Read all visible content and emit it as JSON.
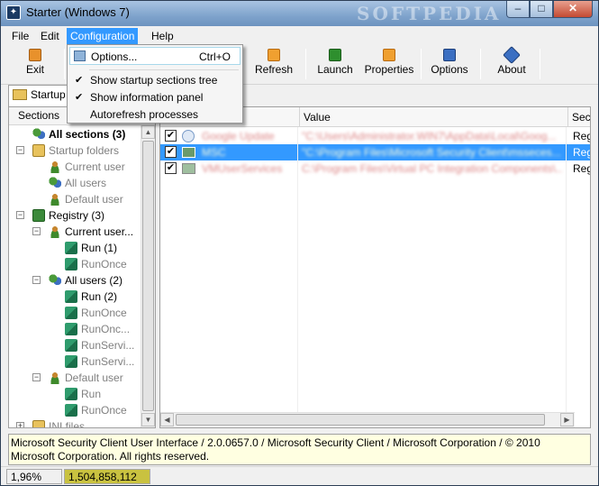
{
  "window": {
    "title": "Starter (Windows 7)",
    "watermark": "SOFTPEDIA",
    "min": "–",
    "max": "□",
    "close": "✕"
  },
  "menubar": {
    "file": "File",
    "edit": "Edit",
    "configuration": "Configuration",
    "help": "Help"
  },
  "toolbar": {
    "exit": "Exit",
    "refresh": "Refresh",
    "launch": "Launch",
    "properties": "Properties",
    "options": "Options",
    "about": "About"
  },
  "tab": {
    "label": "Startup"
  },
  "left": {
    "header": "Sections",
    "items": [
      {
        "label": "All sections (3)"
      },
      {
        "label": "Startup folders"
      },
      {
        "label": "Current user"
      },
      {
        "label": "All users"
      },
      {
        "label": "Default user"
      },
      {
        "label": "Registry (3)"
      },
      {
        "label": "Current user..."
      },
      {
        "label": "Run (1)"
      },
      {
        "label": "RunOnce"
      },
      {
        "label": "All users (2)"
      },
      {
        "label": "Run (2)"
      },
      {
        "label": "RunOnce"
      },
      {
        "label": "RunOnc..."
      },
      {
        "label": "RunServi..."
      },
      {
        "label": "RunServi..."
      },
      {
        "label": "Default user"
      },
      {
        "label": "Run"
      },
      {
        "label": "RunOnce"
      },
      {
        "label": "INI files"
      }
    ]
  },
  "grid": {
    "headers": {
      "value": "Value",
      "section": "Sec"
    },
    "rows": [
      {
        "name": "Google Update",
        "value": "\"C:\\Users\\Administrator.WIN7\\AppData\\Local\\Goog...",
        "section": "Reg"
      },
      {
        "name": "MSC",
        "value": "\"C:\\Program Files\\Microsoft Security Client\\msseces...",
        "section": "Reg"
      },
      {
        "name": "VMUserServices",
        "value": "C:\\Program Files\\Virtual PC Integration Components\\...",
        "section": "Reg"
      }
    ]
  },
  "info": {
    "line1": "Microsoft Security Client User Interface / 2.0.0657.0 / Microsoft Security Client / Microsoft Corporation / © 2010",
    "line2": "Microsoft Corporation. All rights reserved."
  },
  "status": {
    "cpu": "1,96%",
    "memory": "1,504,858,112"
  },
  "dropdown": {
    "options": {
      "label": "Options...",
      "shortcut": "Ctrl+O"
    },
    "show_tree": {
      "label": "Show startup sections tree",
      "check": "✔"
    },
    "show_info": {
      "label": "Show information panel",
      "check": "✔"
    },
    "autorefresh": {
      "label": "Autorefresh processes"
    }
  },
  "colors": {
    "selection": "#3399ff",
    "info_bg": "#ffffe1"
  }
}
